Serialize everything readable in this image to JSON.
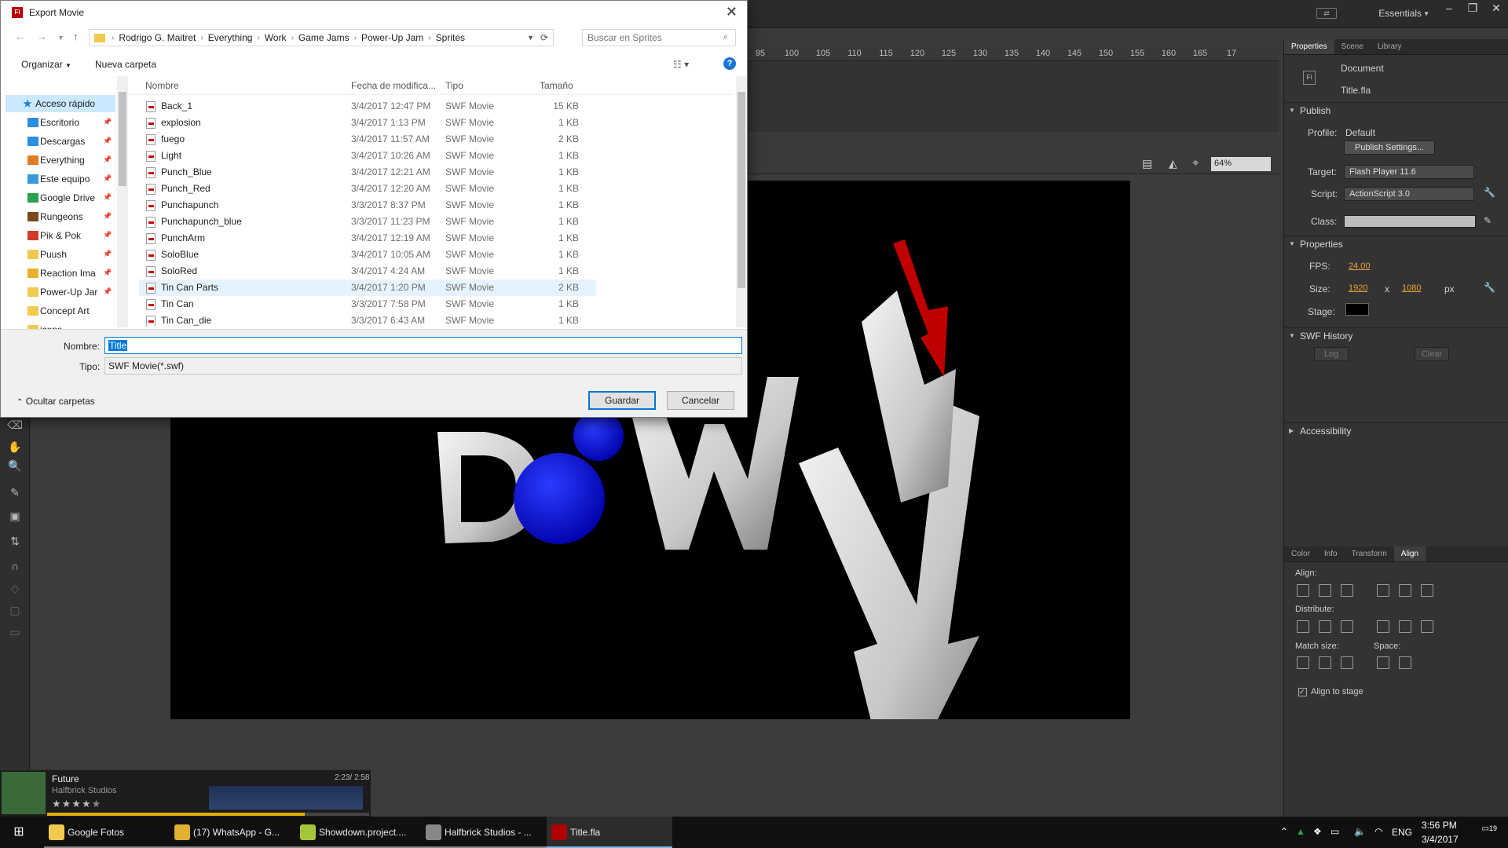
{
  "app": {
    "workspace": "Essentials",
    "ruler_ticks": [
      "95",
      "100",
      "105",
      "110",
      "115",
      "120",
      "125",
      "130",
      "135",
      "140",
      "145",
      "150",
      "155",
      "160",
      "165",
      "17"
    ],
    "zoom": "64%"
  },
  "dialog": {
    "title": "Export Movie",
    "breadcrumb": [
      "Rodrigo G. Maitret",
      "Everything",
      "Work",
      "Game Jams",
      "Power-Up Jam",
      "Sprites"
    ],
    "search_placeholder": "Buscar en Sprites",
    "organize": "Organizar",
    "new_folder": "Nueva carpeta",
    "nav_items": [
      {
        "label": "Acceso rápido",
        "color": "#1e7fd6"
      },
      {
        "label": "Escritorio",
        "color": "#2b8ee0"
      },
      {
        "label": "Descargas",
        "color": "#2b8ee0"
      },
      {
        "label": "Everything",
        "color": "#e07b23"
      },
      {
        "label": "Este equipo",
        "color": "#3a9ad9"
      },
      {
        "label": "Google Drive",
        "color": "#2aa14e"
      },
      {
        "label": "Rungeons",
        "color": "#7a4a1d"
      },
      {
        "label": "Pik & Pok",
        "color": "#d23c2c"
      },
      {
        "label": "Puush",
        "color": "#f1c94e"
      },
      {
        "label": "Reaction Ima",
        "color": "#e8b02a"
      },
      {
        "label": "Power-Up Jar",
        "color": "#f1c94e"
      },
      {
        "label": "Concept Art",
        "color": "#f1c94e"
      },
      {
        "label": "icons",
        "color": "#f1c94e"
      }
    ],
    "columns": {
      "name": "Nombre",
      "date": "Fecha de modifica...",
      "type": "Tipo",
      "size": "Tamaño"
    },
    "files": [
      {
        "name": "Back_1",
        "date": "3/4/2017 12:47 PM",
        "type": "SWF Movie",
        "size": "15 KB"
      },
      {
        "name": "explosion",
        "date": "3/4/2017 1:13 PM",
        "type": "SWF Movie",
        "size": "1 KB"
      },
      {
        "name": "fuego",
        "date": "3/4/2017 11:57 AM",
        "type": "SWF Movie",
        "size": "2 KB"
      },
      {
        "name": "Light",
        "date": "3/4/2017 10:26 AM",
        "type": "SWF Movie",
        "size": "1 KB"
      },
      {
        "name": "Punch_Blue",
        "date": "3/4/2017 12:21 AM",
        "type": "SWF Movie",
        "size": "1 KB"
      },
      {
        "name": "Punch_Red",
        "date": "3/4/2017 12:20 AM",
        "type": "SWF Movie",
        "size": "1 KB"
      },
      {
        "name": "Punchapunch",
        "date": "3/3/2017 8:37 PM",
        "type": "SWF Movie",
        "size": "1 KB"
      },
      {
        "name": "Punchapunch_blue",
        "date": "3/3/2017 11:23 PM",
        "type": "SWF Movie",
        "size": "1 KB"
      },
      {
        "name": "PunchArm",
        "date": "3/4/2017 12:19 AM",
        "type": "SWF Movie",
        "size": "1 KB"
      },
      {
        "name": "SoloBlue",
        "date": "3/4/2017 10:05 AM",
        "type": "SWF Movie",
        "size": "1 KB"
      },
      {
        "name": "SoloRed",
        "date": "3/4/2017 4:24 AM",
        "type": "SWF Movie",
        "size": "1 KB"
      },
      {
        "name": "Tin Can Parts",
        "date": "3/4/2017 1:20 PM",
        "type": "SWF Movie",
        "size": "2 KB"
      },
      {
        "name": "Tin Can",
        "date": "3/3/2017 7:58 PM",
        "type": "SWF Movie",
        "size": "1 KB"
      },
      {
        "name": "Tin Can_die",
        "date": "3/3/2017 6:43 AM",
        "type": "SWF Movie",
        "size": "1 KB"
      }
    ],
    "selected_file": "Tin Can Parts",
    "filename_label": "Nombre:",
    "filename_value": "Title",
    "filetype_label": "Tipo:",
    "filetype_value": "SWF Movie(*.swf)",
    "hide_folders": "Ocultar carpetas",
    "save": "Guardar",
    "cancel": "Cancelar"
  },
  "panel": {
    "tabs": [
      "Properties",
      "Scene",
      "Library"
    ],
    "doc_type": "Document",
    "doc_name": "Title.fla",
    "publish_title": "Publish",
    "profile_label": "Profile:",
    "profile_value": "Default",
    "publish_settings": "Publish Settings...",
    "target_label": "Target:",
    "target_value": "Flash Player 11.6",
    "script_label": "Script:",
    "script_value": "ActionScript 3.0",
    "class_label": "Class:",
    "properties_title": "Properties",
    "fps_label": "FPS:",
    "fps_value": "24.00",
    "size_label": "Size:",
    "width_value": "1920",
    "x_label": "x",
    "height_value": "1080",
    "px_label": "px",
    "stage_label": "Stage:",
    "history_title": "SWF History",
    "log": "Log",
    "clear": "Clear",
    "accessibility_title": "Accessibility",
    "tabs2": [
      "Color",
      "Info",
      "Transform",
      "Align"
    ],
    "align_label": "Align:",
    "distribute_label": "Distribute:",
    "match_label": "Match size:",
    "space_label": "Space:",
    "align_to_stage": "Align to stage"
  },
  "music": {
    "title": "Future",
    "artist": "Halfbrick Studios",
    "time": "2:23/ 2:58",
    "rating": 4
  },
  "taskbar": {
    "items": [
      {
        "label": "Google Fotos",
        "color": "#f1c94e",
        "state": "run"
      },
      {
        "label": "(17) WhatsApp - G...",
        "color": "#e0b030",
        "state": "run"
      },
      {
        "label": "Showdown.project....",
        "color": "#a4c639",
        "state": "run"
      },
      {
        "label": "Halfbrick Studios - ...",
        "color": "#888888",
        "state": "run"
      },
      {
        "label": "Title.fla",
        "color": "#b00000",
        "state": "on"
      }
    ],
    "lang": "ENG",
    "time": "3:56 PM",
    "date": "3/4/2017",
    "notif": "19"
  },
  "colors": {
    "accent": "#0078d7",
    "flash_red": "#b00000",
    "stage_bg": "#000000"
  }
}
